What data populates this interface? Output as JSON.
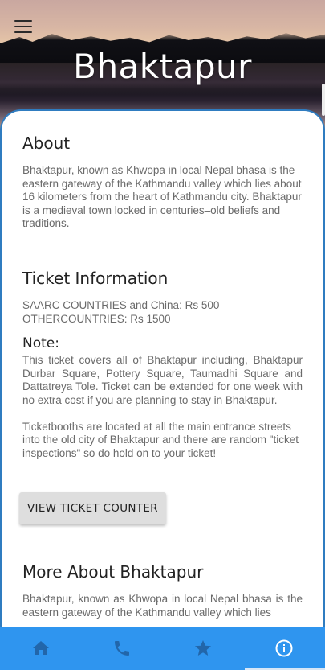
{
  "hero": {
    "title": "Bhaktapur"
  },
  "about": {
    "heading": "About",
    "text": "Bhaktapur, known as Khwopa in  local  Nepal bhasa  is the eastern gateway of the Kathmandu valley which lies about 16 kilometers from  the heart of Kathmandu city. Bhaktapur is  a  medieval town  locked in centuries–old beliefs and traditions."
  },
  "ticket": {
    "heading": "Ticket Information",
    "lines": [
      "SAARC COUNTRIES and China: Rs 500",
      "OTHERCOUNTRIES: Rs 1500"
    ],
    "note_heading": "Note:",
    "note_text": "This ticket covers all of Bhaktapur including,  Bhaktapur Durbar Square, Pottery Square,  Taumadhi  Square  and Dattatreya  Tole.  Ticket  can be extended for  one  week with no extra   cost    if you  are planning to   stay   in Bhaktapur.",
    "booths_text": "Ticketbooths  are located at  all the main entrance streets  into the   old  city of Bhaktapur and there are random  \"ticket inspections\" so do hold on to your ticket!",
    "button_label": "VIEW TICKET COUNTER"
  },
  "more": {
    "heading": "More About Bhaktapur",
    "text": "Bhaktapur,  known as  Khwopa in local Nepal  bhasa is the eastern gateway of the Kathmandu valley which lies"
  },
  "nav": {
    "items": [
      "home-icon",
      "phone-icon",
      "star-icon",
      "info-icon"
    ],
    "active_index": 3,
    "color": "#2f95ef"
  }
}
